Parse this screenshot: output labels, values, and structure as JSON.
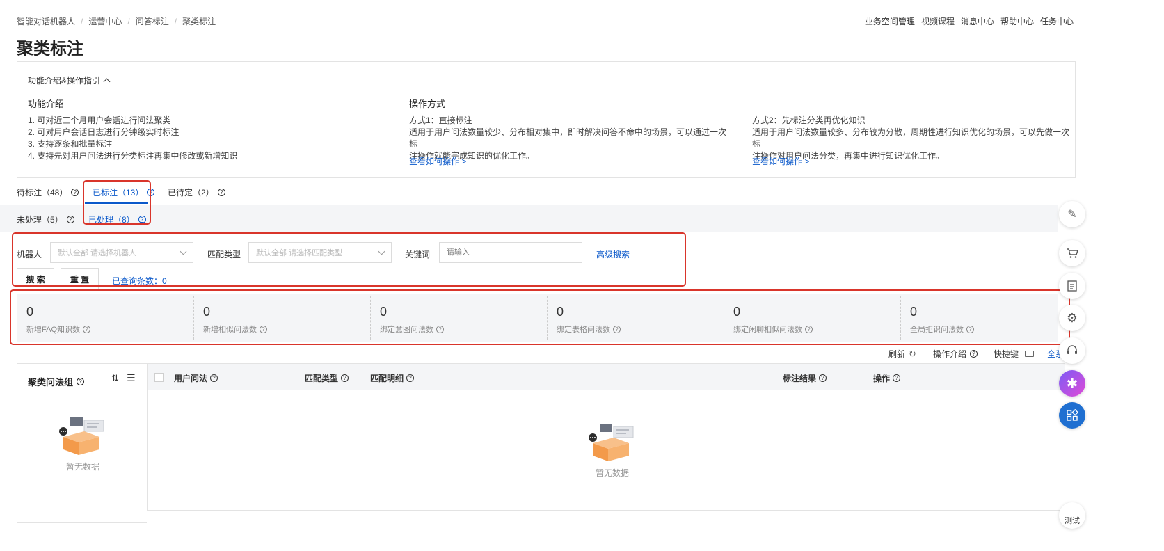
{
  "breadcrumb": [
    "智能对话机器人",
    "运营中心",
    "问答标注",
    "聚类标注"
  ],
  "top_links": [
    "业务空间管理",
    "视频课程",
    "消息中心",
    "帮助中心",
    "任务中心"
  ],
  "page_title": "聚类标注",
  "guide": {
    "toggle_label": "功能介绍&操作指引",
    "intro_title": "功能介绍",
    "intro_items": [
      "1. 可对近三个月用户会话进行问法聚类",
      "2. 可对用户会话日志进行分钟级实时标注",
      "3. 支持逐条和批量标注",
      "4. 支持先对用户问法进行分类标注再集中修改或新增知识"
    ],
    "ops_title": "操作方式",
    "mode1_title": "方式1：直接标注",
    "mode1_desc_1": "适用于用户问法数量较少、分布相对集中，即时解决问答不命中的场景，可以通过一次标",
    "mode1_desc_2": "注操作就能完成知识的优化工作。",
    "mode1_link": "查看如何操作 >",
    "mode2_title": "方式2：先标注分类再优化知识",
    "mode2_desc_1": "适用于用户问法数量较多、分布较为分散，周期性进行知识优化的场景，可以先做一次标",
    "mode2_desc_2": "注操作对用户问法分类，再集中进行知识优化工作。",
    "mode2_link": "查看如何操作 >"
  },
  "tabs": [
    {
      "label": "待标注（48）",
      "active": false
    },
    {
      "label": "已标注（13）",
      "active": true
    },
    {
      "label": "已待定（2）",
      "active": false
    }
  ],
  "sub_tabs": [
    {
      "label": "未处理（5）",
      "active": false
    },
    {
      "label": "已处理（8）",
      "active": true
    }
  ],
  "filters": {
    "robot_label": "机器人",
    "robot_placeholder": "默认全部 请选择机器人",
    "match_label": "匹配类型",
    "match_placeholder": "默认全部 请选择匹配类型",
    "keyword_label": "关键词",
    "keyword_placeholder": "请输入",
    "advanced_search": "高级搜索",
    "search_btn": "搜 索",
    "reset_btn": "重 置",
    "query_count": "已查询条数：0"
  },
  "stats": [
    {
      "value": "0",
      "label": "新增FAQ知识数"
    },
    {
      "value": "0",
      "label": "新增相似问法数"
    },
    {
      "value": "0",
      "label": "绑定意图问法数"
    },
    {
      "value": "0",
      "label": "绑定表格问法数"
    },
    {
      "value": "0",
      "label": "绑定闲聊相似问法数"
    },
    {
      "value": "0",
      "label": "全局拒识问法数"
    }
  ],
  "toolbar": {
    "refresh": "刷新",
    "ops_intro": "操作介绍",
    "shortcut": "快捷键",
    "fullscreen": "全系"
  },
  "left_panel": {
    "title": "聚类问法组",
    "empty": "暂无数据"
  },
  "table": {
    "columns": [
      "用户问法",
      "匹配类型",
      "匹配明细",
      "标注结果",
      "操作"
    ],
    "empty": "暂无数据"
  },
  "side": {
    "test_label": "测试"
  },
  "colors": {
    "accent": "#0a58ca",
    "highlight_box": "#d9352b",
    "band": "#f4f5f7"
  }
}
